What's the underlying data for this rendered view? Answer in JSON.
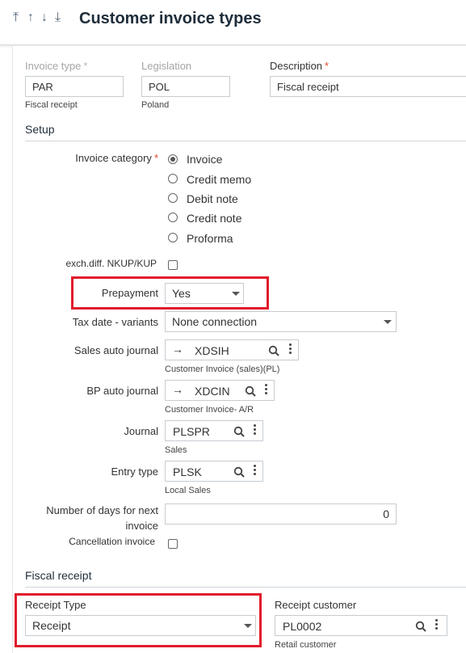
{
  "header": {
    "title": "Customer invoice types",
    "nav": [
      "first-record",
      "previous-record",
      "next-record",
      "last-record"
    ]
  },
  "top_fields": {
    "invoice_type": {
      "label": "Invoice type",
      "value": "PAR",
      "sub": "Fiscal receipt"
    },
    "legislation": {
      "label": "Legislation",
      "value": "POL",
      "sub": "Poland"
    },
    "description": {
      "label": "Description",
      "value": "Fiscal receipt"
    }
  },
  "setup": {
    "section_title": "Setup",
    "invoice_category": {
      "label": "Invoice category",
      "options": [
        "Invoice",
        "Credit memo",
        "Debit note",
        "Credit note",
        "Proforma"
      ],
      "selected": "Invoice"
    },
    "exch_diff": {
      "label": "exch.diff. NKUP/KUP",
      "checked": false
    },
    "prepayment": {
      "label": "Prepayment",
      "value": "Yes"
    },
    "tax_date": {
      "label": "Tax date - variants",
      "value": "None connection"
    },
    "sales_auto_journal": {
      "label": "Sales auto journal",
      "value": "XDSIH",
      "sub": "Customer Invoice (sales)(PL)"
    },
    "bp_auto_journal": {
      "label": "BP auto journal",
      "value": "XDCIN",
      "sub": "Customer Invoice- A/R"
    },
    "journal": {
      "label": "Journal",
      "value": "PLSPR",
      "sub": "Sales"
    },
    "entry_type": {
      "label": "Entry type",
      "value": "PLSK",
      "sub": "Local Sales"
    },
    "days_next_invoice": {
      "label_line1": "Number of days for next",
      "label_line2": "invoice",
      "value": "0"
    },
    "cancellation_invoice": {
      "label": "Cancellation invoice",
      "checked": false
    }
  },
  "fiscal_receipt": {
    "section_title": "Fiscal receipt",
    "receipt_type": {
      "label": "Receipt Type",
      "value": "Receipt"
    },
    "receipt_customer": {
      "label": "Receipt customer",
      "value": "PL0002",
      "sub": "Retail customer"
    }
  },
  "colors": {
    "highlight": "#e11b2b",
    "required": "#e04a2a",
    "title": "#1f2d3a"
  }
}
